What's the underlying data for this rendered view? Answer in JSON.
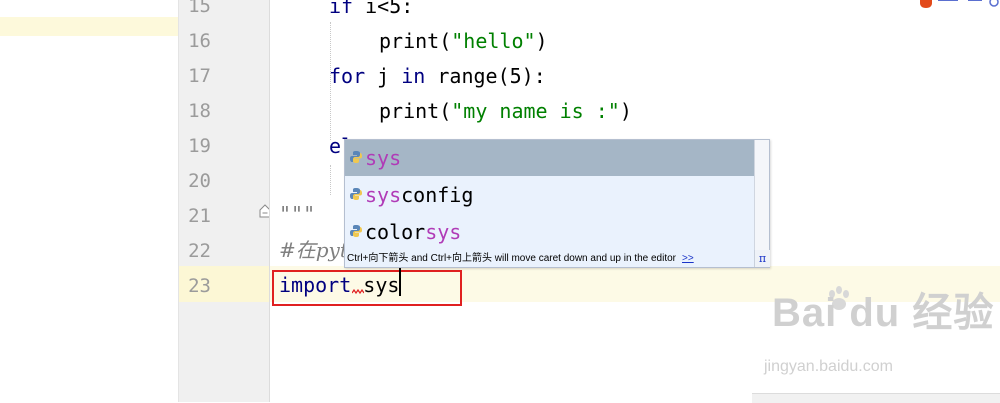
{
  "line_numbers": [
    "15",
    "16",
    "17",
    "18",
    "19",
    "20",
    "21",
    "22",
    "23"
  ],
  "code": {
    "l15_if": "if",
    "l15_rest": " i<5:",
    "l16_fn": "print(",
    "l16_str": "\"hello\"",
    "l16_end": ")",
    "l17_for": "for",
    "l17_mid": " j ",
    "l17_in": "in",
    "l17_rest": " range(5):",
    "l18_fn": "print(",
    "l18_str": "\"my name is :\"",
    "l18_end": ")",
    "l19_partial": "el",
    "l21_docstring": "\"\"\"",
    "l22_comment": "#在pyt",
    "l23_import": "import",
    "l23_module": " sys"
  },
  "completion": {
    "items": [
      {
        "prefix": "",
        "match": "sys",
        "suffix": ""
      },
      {
        "prefix": "",
        "match": "sys",
        "suffix": "config"
      },
      {
        "prefix": "color",
        "match": "sys",
        "suffix": ""
      }
    ],
    "hint": "Ctrl+向下箭头 and Ctrl+向上箭头 will move caret down and up in the editor",
    "hint_link": ">>",
    "pi_button": "π"
  },
  "watermark": {
    "brand": "Bai du 经验",
    "url": "jingyan.baidu.com"
  },
  "colors": {
    "keyword": "#000080",
    "string": "#008000",
    "match_highlight": "#b03bb7",
    "selected_item": "#a5b6c6",
    "highlight_box": "#e02020"
  }
}
